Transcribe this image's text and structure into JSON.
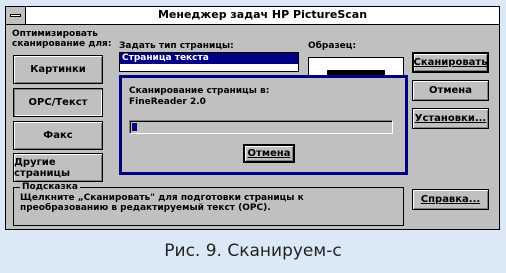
{
  "window": {
    "title": "Менеджер задач HP PictureScan"
  },
  "optimize": {
    "label_line1": "Оптимизировать",
    "label_line2": "сканирование для:",
    "buttons": [
      "Картинки",
      "OPC/Текст",
      "Факс",
      "Другие страницы"
    ]
  },
  "page_type": {
    "label": "Задать тип страницы:",
    "selected": "Страница текста"
  },
  "preview": {
    "label": "Образец:"
  },
  "actions": {
    "scan": "Сканировать",
    "cancel": "Отмена",
    "settings": "Установки...",
    "help": "Справка..."
  },
  "progress_dialog": {
    "line1": "Сканирование страницы в:",
    "line2": "FineReader 2.0",
    "progress_fraction": 0.02,
    "cancel": "Отмена"
  },
  "hint": {
    "title": "Подсказка",
    "text": "Щелкните „Сканировать\" для подготовки страницы к\nпреобразованию в редактируемый текст (OPC)."
  },
  "caption": "Рис. 9. Сканируем-с"
}
